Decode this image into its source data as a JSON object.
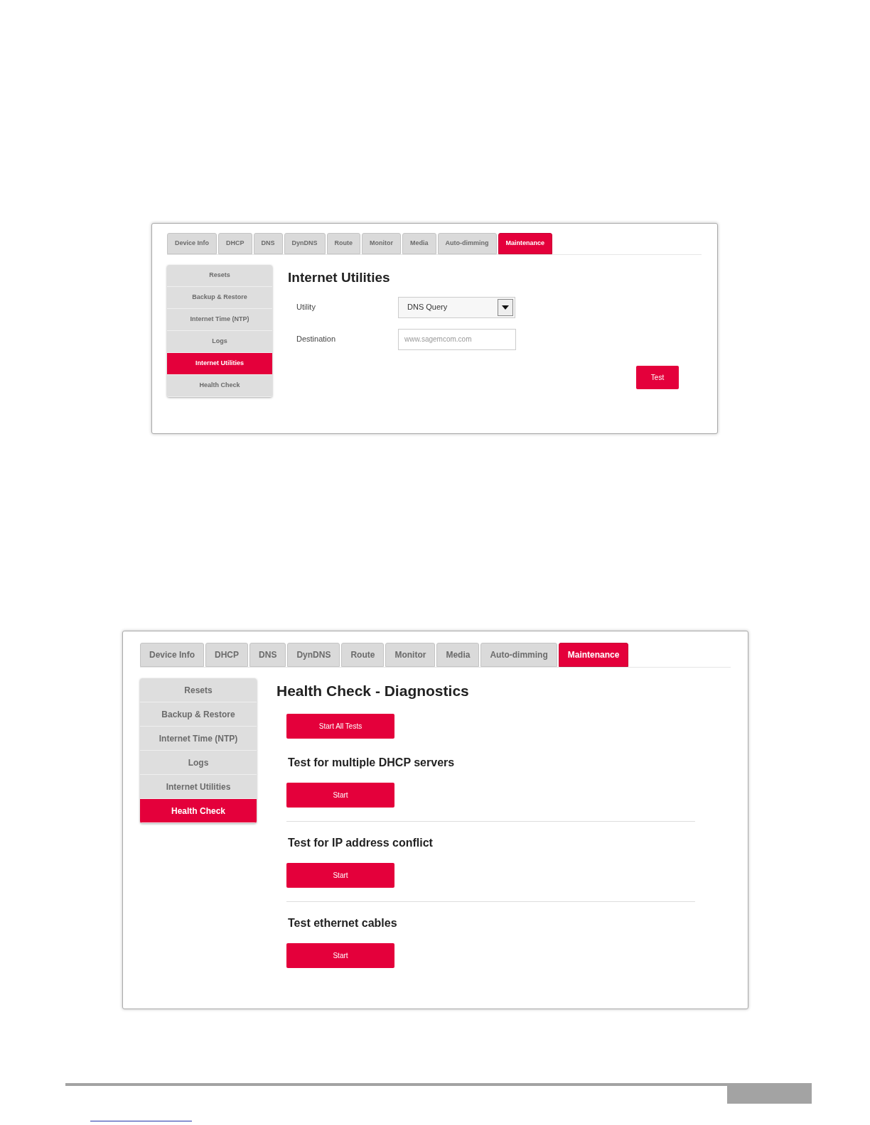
{
  "screens": [
    {
      "kind": "form",
      "tabs": [
        {
          "label": "Device Info",
          "selected": false
        },
        {
          "label": "DHCP",
          "selected": false
        },
        {
          "label": "DNS",
          "selected": false
        },
        {
          "label": "DynDNS",
          "selected": false
        },
        {
          "label": "Route",
          "selected": false
        },
        {
          "label": "Monitor",
          "selected": false
        },
        {
          "label": "Media",
          "selected": false
        },
        {
          "label": "Auto-dimming",
          "selected": false
        },
        {
          "label": "Maintenance",
          "selected": true
        }
      ],
      "sidebar": [
        {
          "label": "Resets",
          "selected": false
        },
        {
          "label": "Backup & Restore",
          "selected": false
        },
        {
          "label": "Internet Time (NTP)",
          "selected": false
        },
        {
          "label": "Logs",
          "selected": false
        },
        {
          "label": "Internet Utilities",
          "selected": true
        },
        {
          "label": "Health Check",
          "selected": false
        }
      ],
      "title": "Internet Utilities",
      "fields": [
        {
          "kind": "select",
          "label": "Utility",
          "value": "DNS Query"
        },
        {
          "kind": "text",
          "label": "Destination",
          "placeholder": "www.sagemcom.com"
        }
      ],
      "button": "Test"
    },
    {
      "kind": "diagnostics",
      "tabs": [
        {
          "label": "Device Info",
          "selected": false
        },
        {
          "label": "DHCP",
          "selected": false
        },
        {
          "label": "DNS",
          "selected": false
        },
        {
          "label": "DynDNS",
          "selected": false
        },
        {
          "label": "Route",
          "selected": false
        },
        {
          "label": "Monitor",
          "selected": false
        },
        {
          "label": "Media",
          "selected": false
        },
        {
          "label": "Auto-dimming",
          "selected": false
        },
        {
          "label": "Maintenance",
          "selected": true
        }
      ],
      "sidebar": [
        {
          "label": "Resets",
          "selected": false
        },
        {
          "label": "Backup & Restore",
          "selected": false
        },
        {
          "label": "Internet Time (NTP)",
          "selected": false
        },
        {
          "label": "Logs",
          "selected": false
        },
        {
          "label": "Internet Utilities",
          "selected": false
        },
        {
          "label": "Health Check",
          "selected": true
        }
      ],
      "title": "Health Check - Diagnostics",
      "start_all": "Start All Tests",
      "tests": [
        {
          "title": "Test for multiple DHCP servers",
          "button": "Start"
        },
        {
          "title": "Test for IP address conflict",
          "button": "Start"
        },
        {
          "title": "Test ethernet cables",
          "button": "Start"
        }
      ]
    }
  ]
}
